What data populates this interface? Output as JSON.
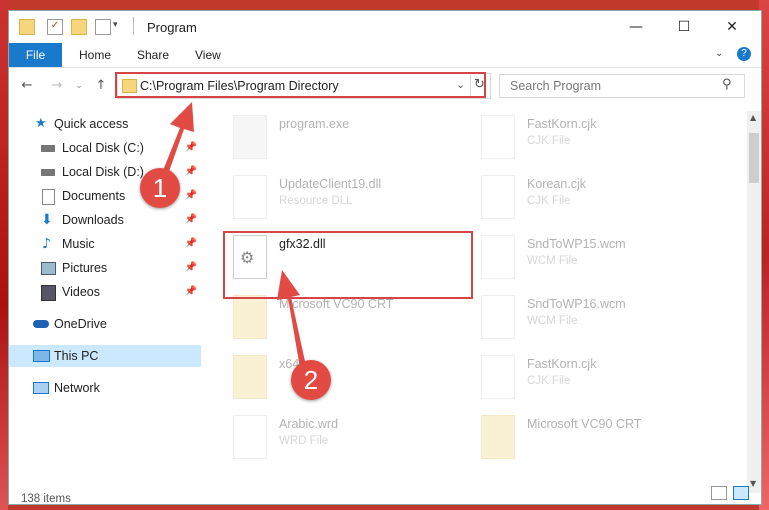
{
  "window": {
    "title": "Program"
  },
  "ribbon": {
    "tabs": [
      "File",
      "Home",
      "Share",
      "View"
    ]
  },
  "address": {
    "path": "C:\\Program Files\\Program Directory"
  },
  "search": {
    "placeholder": "Search Program"
  },
  "nav": {
    "items": [
      {
        "label": "Quick access",
        "icon": "star-icon"
      },
      {
        "label": "Local Disk (C:)",
        "icon": "drive-icon"
      },
      {
        "label": "Local Disk (D:)",
        "icon": "drive-icon"
      },
      {
        "label": "Documents",
        "icon": "documents-icon"
      },
      {
        "label": "Downloads",
        "icon": "download-icon"
      },
      {
        "label": "Music",
        "icon": "music-icon"
      },
      {
        "label": "Pictures",
        "icon": "pictures-icon"
      },
      {
        "label": "Videos",
        "icon": "videos-icon"
      },
      {
        "label": "OneDrive",
        "icon": "cloud-icon"
      },
      {
        "label": "This PC",
        "icon": "computer-icon"
      },
      {
        "label": "Network",
        "icon": "network-icon"
      }
    ]
  },
  "files": {
    "left": [
      {
        "name": "program.exe",
        "type": ""
      },
      {
        "name": "UpdateClient19.dll",
        "type": "Resource DLL"
      },
      {
        "name": "gfx32.dll",
        "type": ""
      },
      {
        "name": "Microsoft VC90 CRT",
        "type": ""
      },
      {
        "name": "x64",
        "type": ""
      },
      {
        "name": "Arabic.wrd",
        "type": "WRD File"
      }
    ],
    "right": [
      {
        "name": "FastKorn.cjk",
        "type": "CJK File"
      },
      {
        "name": "Korean.cjk",
        "type": "CJK File"
      },
      {
        "name": "SndToWP15.wcm",
        "type": "WCM File"
      },
      {
        "name": "SndToWP16.wcm",
        "type": "WCM File"
      },
      {
        "name": "FastKorn.cjk",
        "type": "CJK File"
      },
      {
        "name": "Microsoft VC90 CRT",
        "type": ""
      }
    ]
  },
  "status": {
    "count": "138 items"
  },
  "callouts": [
    "1",
    "2"
  ],
  "colors": {
    "accent": "#1979ca",
    "highlight": "#d64545",
    "selected": "#cce8ff"
  }
}
